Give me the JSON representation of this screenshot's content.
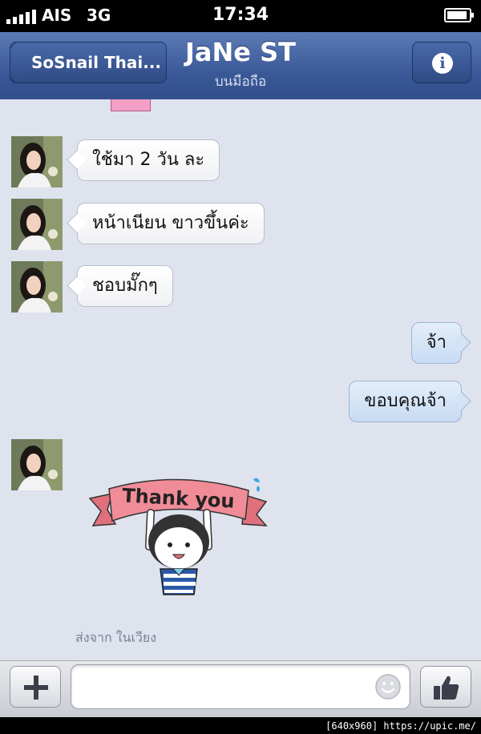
{
  "status_bar": {
    "carrier": "AIS",
    "network": "3G",
    "time": "17:34"
  },
  "nav": {
    "back_label": "SoSnail Thai...",
    "title": "JaNe ST",
    "subtitle": "บนมือถือ",
    "info_icon": "info-icon"
  },
  "messages": [
    {
      "from": "contact",
      "text": "ใช้มา 2 วัน ละ"
    },
    {
      "from": "contact",
      "text": "หน้าเนียน ขาวขึ้นค่ะ"
    },
    {
      "from": "contact",
      "text": "ชอบมั๊กๆ"
    },
    {
      "from": "me",
      "text": "จ้า"
    },
    {
      "from": "me",
      "text": "ขอบคุณจ้า"
    }
  ],
  "sticker": {
    "text": "Thank you"
  },
  "sent_from": "ส่งจาก ในเวียง",
  "composer": {
    "add_icon": "plus-icon",
    "emoji_icon": "smiley-icon",
    "like_icon": "thumbs-up-icon",
    "value": ""
  },
  "watermark": "[640x960] https://upic.me/",
  "colors": {
    "navbar": "#3b5998",
    "chat_background": "#dfe3ee",
    "outgoing_bubble": "#c8dbf3",
    "incoming_bubble": "#ffffff"
  }
}
